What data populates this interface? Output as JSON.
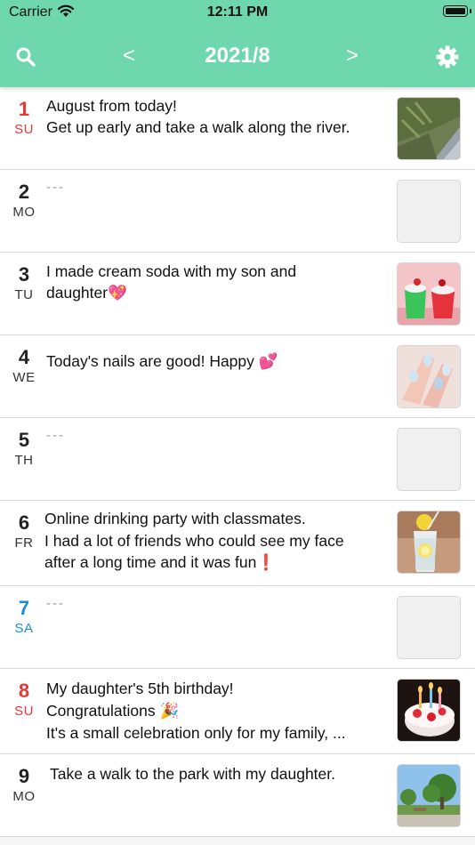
{
  "status_bar": {
    "carrier": "Carrier",
    "time": "12:11 PM"
  },
  "header": {
    "title": "2021/8",
    "prev_label": "<",
    "next_label": ">",
    "search_icon": "search-icon",
    "settings_icon": "gear-icon",
    "background_color": "#6fd7ad"
  },
  "entries": [
    {
      "day": "1",
      "weekday": "SU",
      "text": "August from today!\nGet up early and take a walk along the river.",
      "thumbnail": "photo-riverside-grass"
    },
    {
      "day": "2",
      "weekday": "MO",
      "text": "---",
      "thumbnail": "empty"
    },
    {
      "day": "3",
      "weekday": "TU",
      "text": "I made cream soda with my son and\ndaughter💖",
      "thumbnail": "photo-cream-soda"
    },
    {
      "day": "4",
      "weekday": "WE",
      "text": "Today's nails are good!  Happy 💕",
      "thumbnail": "photo-nails"
    },
    {
      "day": "5",
      "weekday": "TH",
      "text": "---",
      "thumbnail": "empty"
    },
    {
      "day": "6",
      "weekday": "FR",
      "text": "Online drinking party with classmates.\nI had a lot of friends who could see my face\nafter a long time and it was fun❗",
      "thumbnail": "photo-lemon-drink"
    },
    {
      "day": "7",
      "weekday": "SA",
      "text": "---",
      "thumbnail": "empty"
    },
    {
      "day": "8",
      "weekday": "SU",
      "text": "My daughter's 5th birthday!\nCongratulations 🎉\nIt's a small celebration only for my family, ...",
      "thumbnail": "photo-birthday-cake"
    },
    {
      "day": "9",
      "weekday": "MO",
      "text": "Take a walk to the park with my daughter.",
      "thumbnail": "photo-park"
    }
  ],
  "colors": {
    "sunday": "#e53935",
    "saturday": "#1e88e5"
  }
}
